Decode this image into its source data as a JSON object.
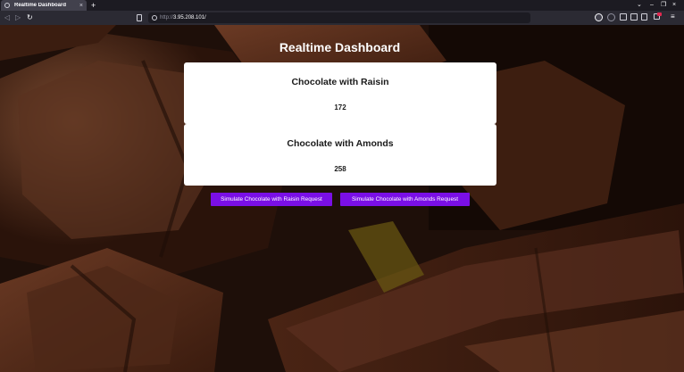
{
  "browser": {
    "tab": {
      "title": "Realtime Dashboard",
      "close": "×"
    },
    "new_tab": "+",
    "window_controls": {
      "minimize": "–",
      "restore": "❐",
      "close": "×",
      "list": "⌄"
    },
    "nav": {
      "back": "◁",
      "forward": "▷",
      "reload": "↻"
    },
    "url": {
      "scheme": "http://",
      "host": "3.95.208.101/"
    },
    "menu": "≡"
  },
  "page": {
    "title": "Realtime Dashboard",
    "cards": [
      {
        "title": "Chocolate with Raisin",
        "count": "172"
      },
      {
        "title": "Chocolate with Amonds",
        "count": "258"
      }
    ],
    "buttons": [
      {
        "label": "Simulate Chocolate with Raisin Request"
      },
      {
        "label": "Simulate Chocolate with Amonds Request"
      }
    ],
    "colors": {
      "button_bg": "#7a0fe6",
      "card_bg": "#ffffff",
      "background": "#1e0f09"
    }
  }
}
